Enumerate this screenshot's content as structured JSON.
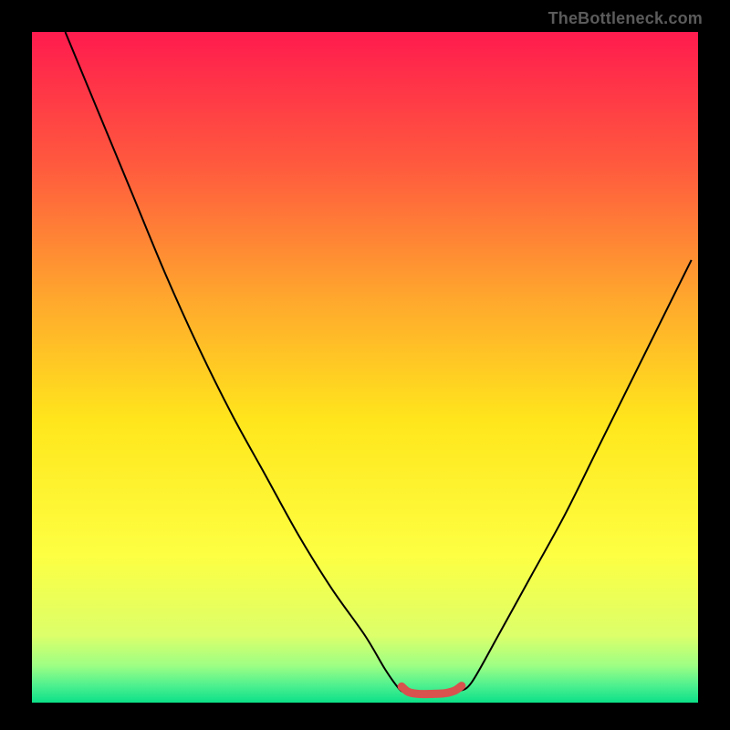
{
  "watermark": "TheBottleneck.com",
  "chart_data": {
    "type": "line",
    "title": "",
    "xlabel": "",
    "ylabel": "",
    "xlim": [
      0,
      100
    ],
    "ylim": [
      0,
      100
    ],
    "grid": false,
    "legend": false,
    "background_gradient": {
      "stops": [
        {
          "offset": 0.0,
          "color": "#ff1b4e"
        },
        {
          "offset": 0.2,
          "color": "#ff5a3e"
        },
        {
          "offset": 0.4,
          "color": "#ffa82d"
        },
        {
          "offset": 0.58,
          "color": "#ffe61c"
        },
        {
          "offset": 0.78,
          "color": "#fdff42"
        },
        {
          "offset": 0.9,
          "color": "#dcff6a"
        },
        {
          "offset": 0.945,
          "color": "#9dff84"
        },
        {
          "offset": 0.975,
          "color": "#4cf08f"
        },
        {
          "offset": 1.0,
          "color": "#0ce088"
        }
      ]
    },
    "series": [
      {
        "name": "bottleneck-curve",
        "color": "#000000",
        "stroke_width": 2,
        "points": [
          {
            "x": 5,
            "y": 100
          },
          {
            "x": 10,
            "y": 88
          },
          {
            "x": 15,
            "y": 76
          },
          {
            "x": 20,
            "y": 64
          },
          {
            "x": 25,
            "y": 53
          },
          {
            "x": 30,
            "y": 43
          },
          {
            "x": 35,
            "y": 34
          },
          {
            "x": 40,
            "y": 25
          },
          {
            "x": 45,
            "y": 17
          },
          {
            "x": 50,
            "y": 10
          },
          {
            "x": 53,
            "y": 5
          },
          {
            "x": 55,
            "y": 2.2
          },
          {
            "x": 56,
            "y": 1.5
          },
          {
            "x": 58,
            "y": 1.2
          },
          {
            "x": 60,
            "y": 1.2
          },
          {
            "x": 62,
            "y": 1.3
          },
          {
            "x": 64,
            "y": 1.7
          },
          {
            "x": 66,
            "y": 3
          },
          {
            "x": 70,
            "y": 10
          },
          {
            "x": 75,
            "y": 19
          },
          {
            "x": 80,
            "y": 28
          },
          {
            "x": 85,
            "y": 38
          },
          {
            "x": 90,
            "y": 48
          },
          {
            "x": 95,
            "y": 58
          },
          {
            "x": 99,
            "y": 66
          }
        ]
      },
      {
        "name": "optimal-zone-marker",
        "color": "#d8524e",
        "stroke_width": 9,
        "linecap": "round",
        "points": [
          {
            "x": 55.5,
            "y": 2.4
          },
          {
            "x": 56.5,
            "y": 1.6
          },
          {
            "x": 58.0,
            "y": 1.3
          },
          {
            "x": 60.0,
            "y": 1.3
          },
          {
            "x": 62.0,
            "y": 1.4
          },
          {
            "x": 63.5,
            "y": 1.8
          },
          {
            "x": 64.5,
            "y": 2.5
          }
        ]
      }
    ]
  }
}
